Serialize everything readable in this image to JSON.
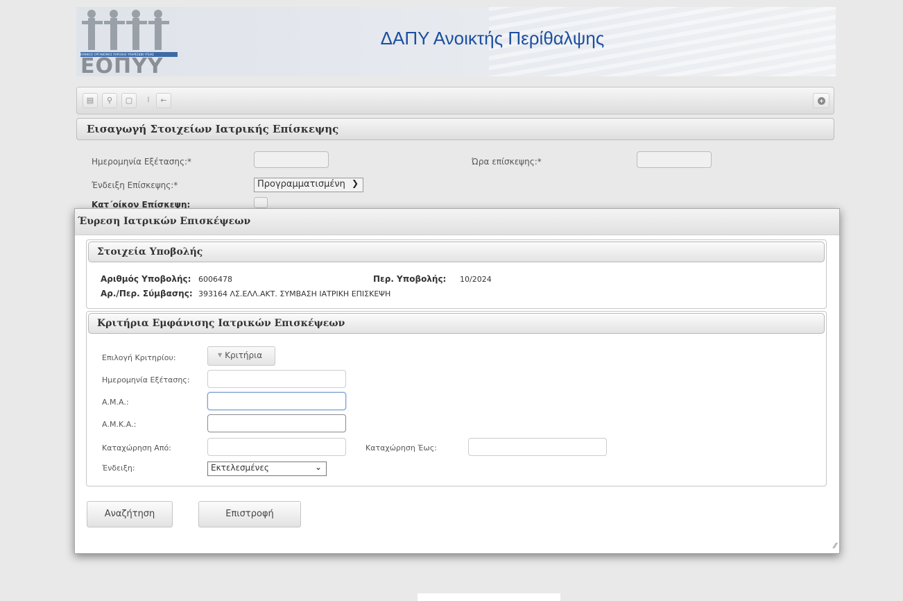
{
  "header": {
    "title": "ΔΑΠΥ Ανοικτής Περίθαλψης",
    "logo_text": "ΕΟΠΥΥ",
    "logo_strip": "ΕΘΝΙΚΟΣ ΟΡΓΑΝΙΣΜΟΣ ΠΑΡΟΧΗΣ ΥΠΗΡΕΣΙΩΝ ΥΓΕΙΑΣ"
  },
  "toolbar": {
    "icons": [
      "save-icon",
      "search-icon",
      "new-document-icon",
      "separator-icon",
      "back-arrow-icon",
      "add-circle-icon"
    ],
    "glyphs": {
      "save": "▤",
      "search": "⚲",
      "new": "▢",
      "sep": "⁞",
      "back": "←"
    }
  },
  "background_form": {
    "title": "Εισαγωγή Στοιχείων Ιατρικής Επίσκεψης",
    "exam_date_label": "Ημερομηνία Εξέτασης:*",
    "visit_time_label": "Ώρα επίσκεψης:*",
    "visit_indication_label": "Ένδειξη Επίσκεψης:*",
    "visit_indication_value": "Προγραμματισμένη",
    "home_visit_label": "Κατ΄οίκον Επίσκεψη:"
  },
  "modal": {
    "title": "Έυρεση Ιατρικών Επισκέψεων",
    "submission": {
      "title": "Στοιχεία Υποβολής",
      "number_label": "Αριθμός Υποβολής:",
      "number_value": "6006478",
      "period_label": "Περ. Υποβολής:",
      "period_value": "10/2024",
      "contract_label": "Αρ./Περ. Σύμβασης:",
      "contract_value": "393164 ΛΣ.ΕΛΛ.ΑΚΤ. ΣΥΜΒΑΣΗ ΙΑΤΡΙΚΗ ΕΠΙΣΚΕΨΗ"
    },
    "criteria": {
      "title": "Κριτήρια Εμφάνισης Ιατρικών Επισκέψεων",
      "select_criterion_label": "Επιλογή Κριτηρίου:",
      "criteria_button": "Κριτήρια",
      "exam_date_label": "Ημερομηνία Εξέτασης:",
      "ama_label": "Α.Μ.Α.:",
      "amka_label": "Α.Μ.Κ.Α.:",
      "entry_from_label": "Καταχώρηση Από:",
      "entry_to_label": "Καταχώρηση Έως:",
      "indication_label": "Ένδειξη:",
      "indication_value": "Εκτελεσμένες"
    },
    "buttons": {
      "search": "Αναζήτηση",
      "back": "Επιστροφή"
    }
  }
}
